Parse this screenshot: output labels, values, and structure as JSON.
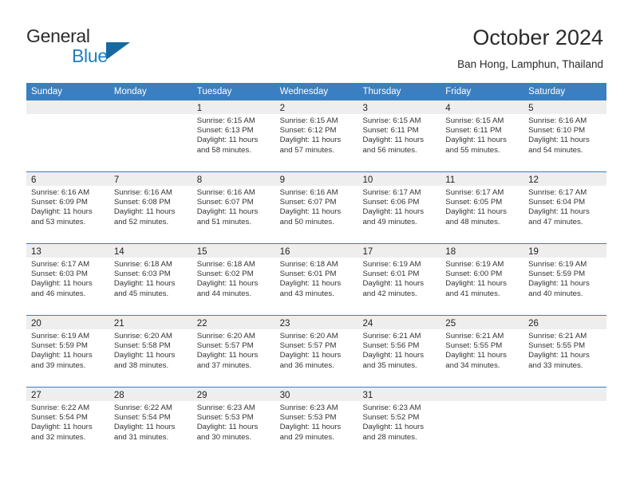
{
  "brand": {
    "name_part1": "General",
    "name_part2": "Blue",
    "logo_icon": "triangle-logo-icon",
    "accent_color": "#1d7fc3"
  },
  "header": {
    "title": "October 2024",
    "subtitle": "Ban Hong, Lamphun, Thailand"
  },
  "calendar": {
    "header_bg_color": "#3a7fc1",
    "weekdays": [
      "Sunday",
      "Monday",
      "Tuesday",
      "Wednesday",
      "Thursday",
      "Friday",
      "Saturday"
    ],
    "weeks": [
      [
        {
          "day": "",
          "empty": true
        },
        {
          "day": "",
          "empty": true
        },
        {
          "day": "1",
          "sunrise": "Sunrise: 6:15 AM",
          "sunset": "Sunset: 6:13 PM",
          "daylight": "Daylight: 11 hours and 58 minutes."
        },
        {
          "day": "2",
          "sunrise": "Sunrise: 6:15 AM",
          "sunset": "Sunset: 6:12 PM",
          "daylight": "Daylight: 11 hours and 57 minutes."
        },
        {
          "day": "3",
          "sunrise": "Sunrise: 6:15 AM",
          "sunset": "Sunset: 6:11 PM",
          "daylight": "Daylight: 11 hours and 56 minutes."
        },
        {
          "day": "4",
          "sunrise": "Sunrise: 6:15 AM",
          "sunset": "Sunset: 6:11 PM",
          "daylight": "Daylight: 11 hours and 55 minutes."
        },
        {
          "day": "5",
          "sunrise": "Sunrise: 6:16 AM",
          "sunset": "Sunset: 6:10 PM",
          "daylight": "Daylight: 11 hours and 54 minutes."
        }
      ],
      [
        {
          "day": "6",
          "sunrise": "Sunrise: 6:16 AM",
          "sunset": "Sunset: 6:09 PM",
          "daylight": "Daylight: 11 hours and 53 minutes."
        },
        {
          "day": "7",
          "sunrise": "Sunrise: 6:16 AM",
          "sunset": "Sunset: 6:08 PM",
          "daylight": "Daylight: 11 hours and 52 minutes."
        },
        {
          "day": "8",
          "sunrise": "Sunrise: 6:16 AM",
          "sunset": "Sunset: 6:07 PM",
          "daylight": "Daylight: 11 hours and 51 minutes."
        },
        {
          "day": "9",
          "sunrise": "Sunrise: 6:16 AM",
          "sunset": "Sunset: 6:07 PM",
          "daylight": "Daylight: 11 hours and 50 minutes."
        },
        {
          "day": "10",
          "sunrise": "Sunrise: 6:17 AM",
          "sunset": "Sunset: 6:06 PM",
          "daylight": "Daylight: 11 hours and 49 minutes."
        },
        {
          "day": "11",
          "sunrise": "Sunrise: 6:17 AM",
          "sunset": "Sunset: 6:05 PM",
          "daylight": "Daylight: 11 hours and 48 minutes."
        },
        {
          "day": "12",
          "sunrise": "Sunrise: 6:17 AM",
          "sunset": "Sunset: 6:04 PM",
          "daylight": "Daylight: 11 hours and 47 minutes."
        }
      ],
      [
        {
          "day": "13",
          "sunrise": "Sunrise: 6:17 AM",
          "sunset": "Sunset: 6:03 PM",
          "daylight": "Daylight: 11 hours and 46 minutes."
        },
        {
          "day": "14",
          "sunrise": "Sunrise: 6:18 AM",
          "sunset": "Sunset: 6:03 PM",
          "daylight": "Daylight: 11 hours and 45 minutes."
        },
        {
          "day": "15",
          "sunrise": "Sunrise: 6:18 AM",
          "sunset": "Sunset: 6:02 PM",
          "daylight": "Daylight: 11 hours and 44 minutes."
        },
        {
          "day": "16",
          "sunrise": "Sunrise: 6:18 AM",
          "sunset": "Sunset: 6:01 PM",
          "daylight": "Daylight: 11 hours and 43 minutes."
        },
        {
          "day": "17",
          "sunrise": "Sunrise: 6:19 AM",
          "sunset": "Sunset: 6:01 PM",
          "daylight": "Daylight: 11 hours and 42 minutes."
        },
        {
          "day": "18",
          "sunrise": "Sunrise: 6:19 AM",
          "sunset": "Sunset: 6:00 PM",
          "daylight": "Daylight: 11 hours and 41 minutes."
        },
        {
          "day": "19",
          "sunrise": "Sunrise: 6:19 AM",
          "sunset": "Sunset: 5:59 PM",
          "daylight": "Daylight: 11 hours and 40 minutes."
        }
      ],
      [
        {
          "day": "20",
          "sunrise": "Sunrise: 6:19 AM",
          "sunset": "Sunset: 5:59 PM",
          "daylight": "Daylight: 11 hours and 39 minutes."
        },
        {
          "day": "21",
          "sunrise": "Sunrise: 6:20 AM",
          "sunset": "Sunset: 5:58 PM",
          "daylight": "Daylight: 11 hours and 38 minutes."
        },
        {
          "day": "22",
          "sunrise": "Sunrise: 6:20 AM",
          "sunset": "Sunset: 5:57 PM",
          "daylight": "Daylight: 11 hours and 37 minutes."
        },
        {
          "day": "23",
          "sunrise": "Sunrise: 6:20 AM",
          "sunset": "Sunset: 5:57 PM",
          "daylight": "Daylight: 11 hours and 36 minutes."
        },
        {
          "day": "24",
          "sunrise": "Sunrise: 6:21 AM",
          "sunset": "Sunset: 5:56 PM",
          "daylight": "Daylight: 11 hours and 35 minutes."
        },
        {
          "day": "25",
          "sunrise": "Sunrise: 6:21 AM",
          "sunset": "Sunset: 5:55 PM",
          "daylight": "Daylight: 11 hours and 34 minutes."
        },
        {
          "day": "26",
          "sunrise": "Sunrise: 6:21 AM",
          "sunset": "Sunset: 5:55 PM",
          "daylight": "Daylight: 11 hours and 33 minutes."
        }
      ],
      [
        {
          "day": "27",
          "sunrise": "Sunrise: 6:22 AM",
          "sunset": "Sunset: 5:54 PM",
          "daylight": "Daylight: 11 hours and 32 minutes."
        },
        {
          "day": "28",
          "sunrise": "Sunrise: 6:22 AM",
          "sunset": "Sunset: 5:54 PM",
          "daylight": "Daylight: 11 hours and 31 minutes."
        },
        {
          "day": "29",
          "sunrise": "Sunrise: 6:23 AM",
          "sunset": "Sunset: 5:53 PM",
          "daylight": "Daylight: 11 hours and 30 minutes."
        },
        {
          "day": "30",
          "sunrise": "Sunrise: 6:23 AM",
          "sunset": "Sunset: 5:53 PM",
          "daylight": "Daylight: 11 hours and 29 minutes."
        },
        {
          "day": "31",
          "sunrise": "Sunrise: 6:23 AM",
          "sunset": "Sunset: 5:52 PM",
          "daylight": "Daylight: 11 hours and 28 minutes."
        },
        {
          "day": "",
          "empty": true
        },
        {
          "day": "",
          "empty": true
        }
      ]
    ]
  }
}
